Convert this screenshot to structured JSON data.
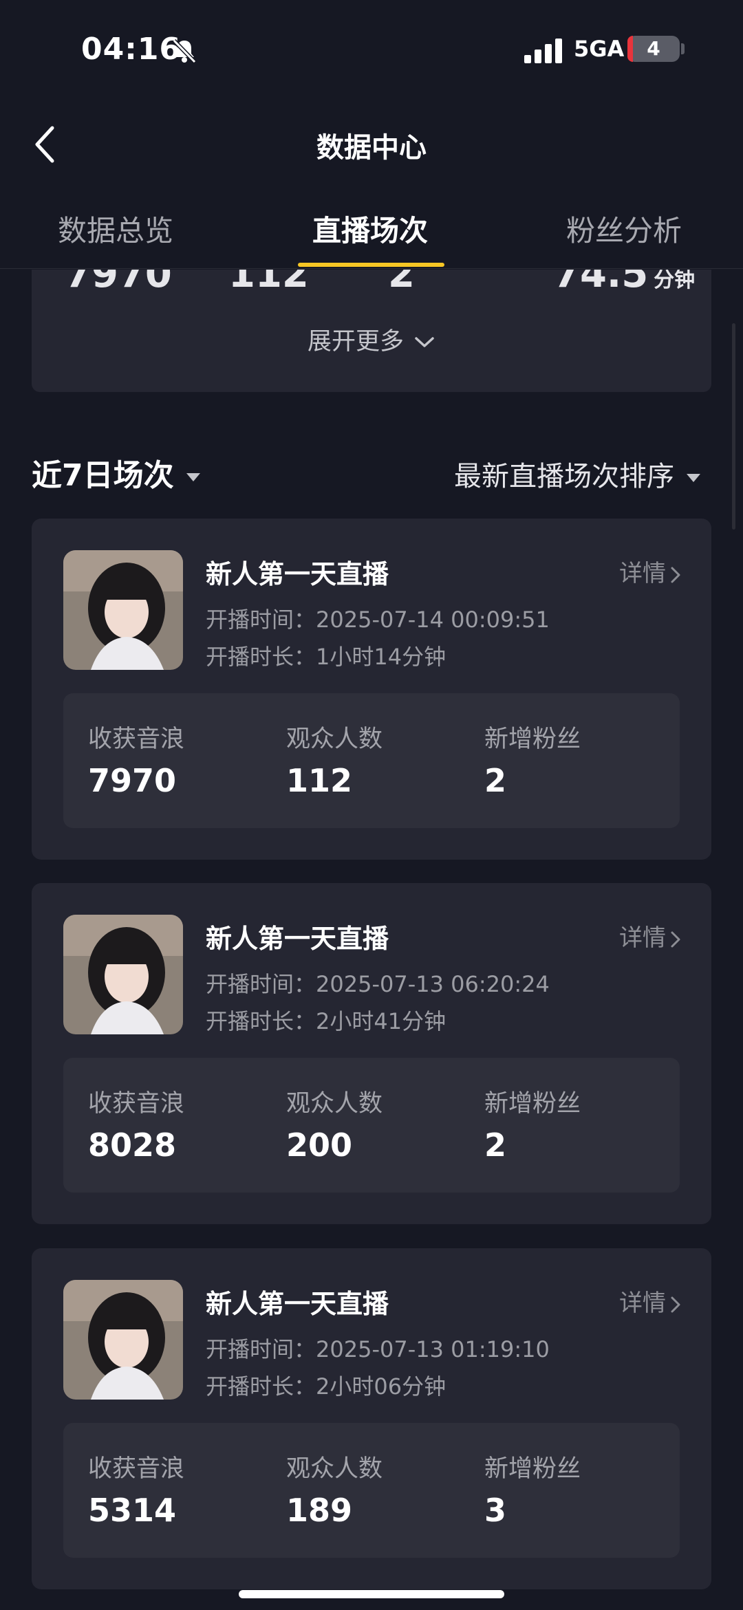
{
  "status": {
    "time": "04:16",
    "network": "5GA",
    "battery": "4"
  },
  "nav": {
    "title": "数据中心"
  },
  "tabs": [
    {
      "label": "数据总览"
    },
    {
      "label": "直播场次"
    },
    {
      "label": "粉丝分析"
    }
  ],
  "summary": {
    "values": [
      "7970",
      "112",
      "2",
      "74.5"
    ],
    "duration_unit": "分钟",
    "expand_label": "展开更多"
  },
  "filter": {
    "range_label": "近7日场次",
    "sort_label": "最新直播场次排序"
  },
  "stat_labels": [
    "收获音浪",
    "观众人数",
    "新增粉丝"
  ],
  "sessions": [
    {
      "title": "新人第一天直播",
      "detail": "详情",
      "start_label": "开播时间：",
      "start_time": "2025-07-14 00:09:51",
      "duration_label": "开播时长：",
      "duration": "1小时14分钟",
      "stats": [
        "7970",
        "112",
        "2"
      ]
    },
    {
      "title": "新人第一天直播",
      "detail": "详情",
      "start_label": "开播时间：",
      "start_time": "2025-07-13 06:20:24",
      "duration_label": "开播时长：",
      "duration": "2小时41分钟",
      "stats": [
        "8028",
        "200",
        "2"
      ]
    },
    {
      "title": "新人第一天直播",
      "detail": "详情",
      "start_label": "开播时间：",
      "start_time": "2025-07-13 01:19:10",
      "duration_label": "开播时长：",
      "duration": "2小时06分钟",
      "stats": [
        "5314",
        "189",
        "3"
      ]
    }
  ],
  "colors": {
    "background": "#161823",
    "card": "#252632",
    "stats_box": "#2e2f3a",
    "accent": "#f6c624",
    "low_battery": "#e8343c"
  }
}
